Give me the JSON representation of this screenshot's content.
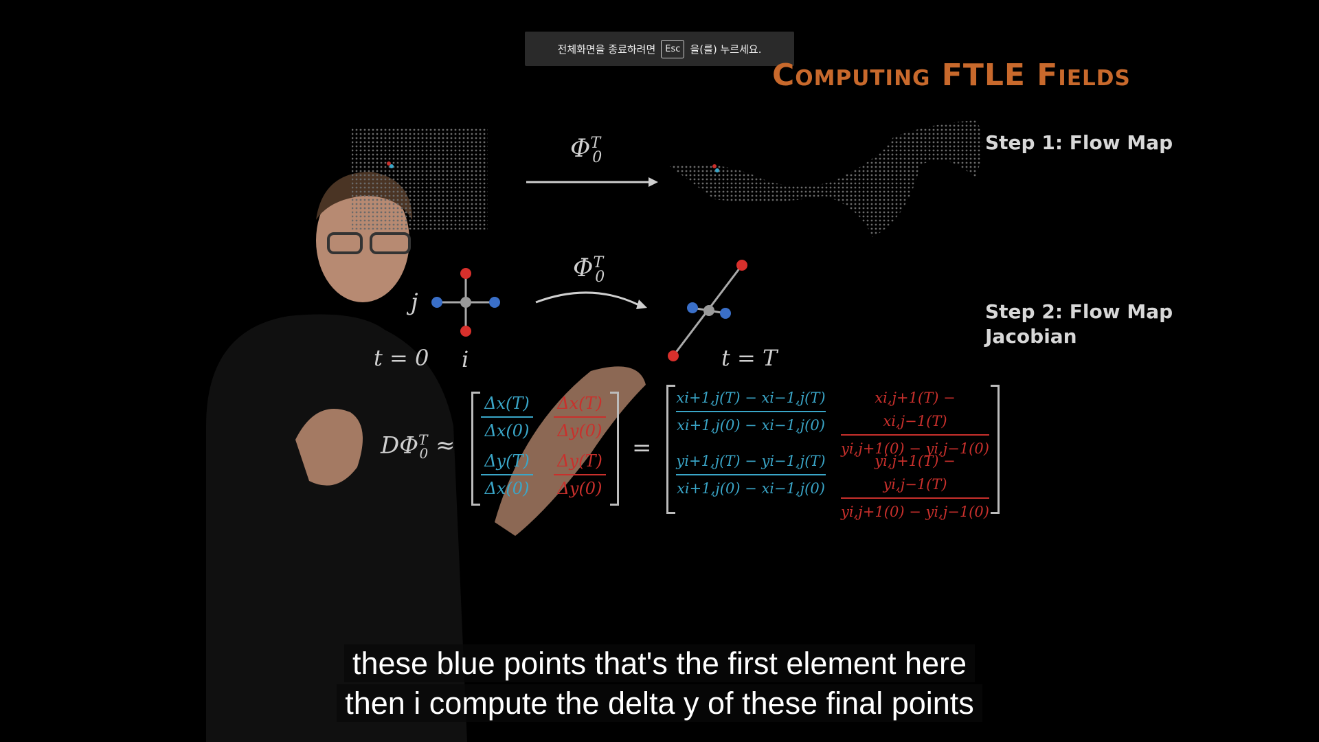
{
  "fullscreen_notice": {
    "before": "전체화면을 종료하려면",
    "key": "Esc",
    "after": "을(를) 누르세요."
  },
  "slide": {
    "title": "Computing FTLE Fields",
    "step1": "Step 1: Flow Map",
    "step2_line1": "Step 2: Flow Map",
    "step2_line2": "Jacobian",
    "phi_top": "Φ",
    "phi_sup": "T",
    "phi_sub": "0",
    "label_j": "j",
    "label_i": "i",
    "label_t0": "t = 0",
    "label_tT": "t = T",
    "jacobian_lhs": "DΦ",
    "approx": "≈",
    "equals": "=",
    "m_a_num": "Δx(T)",
    "m_a_den": "Δx(0)",
    "m_b_num": "Δx(T)",
    "m_b_den": "Δy(0)",
    "m_c_num": "Δy(T)",
    "m_c_den": "Δx(0)",
    "m_d_num": "Δy(T)",
    "m_d_den": "Δy(0)",
    "r_a_num": "xi+1,j(T) − xi−1,j(T)",
    "r_a_den": "xi+1,j(0) − xi−1,j(0)",
    "r_b_num": "xi,j+1(T) − xi,j−1(T)",
    "r_b_den": "yi,j+1(0) − yi,j−1(0)",
    "r_c_num": "yi+1,j(T) − yi−1,j(T)",
    "r_c_den": "xi+1,j(0) − xi−1,j(0)",
    "r_d_num": "yi,j+1(T) − yi,j−1(T)",
    "r_d_den": "yi,j+1(0) − yi,j−1(0)"
  },
  "captions": {
    "line1": "these blue points that's the first element here",
    "line2": "then i compute the delta y of these final points"
  },
  "colors": {
    "title": "#c8692c",
    "blue": "#3aa6c8",
    "red": "#c9302c"
  }
}
